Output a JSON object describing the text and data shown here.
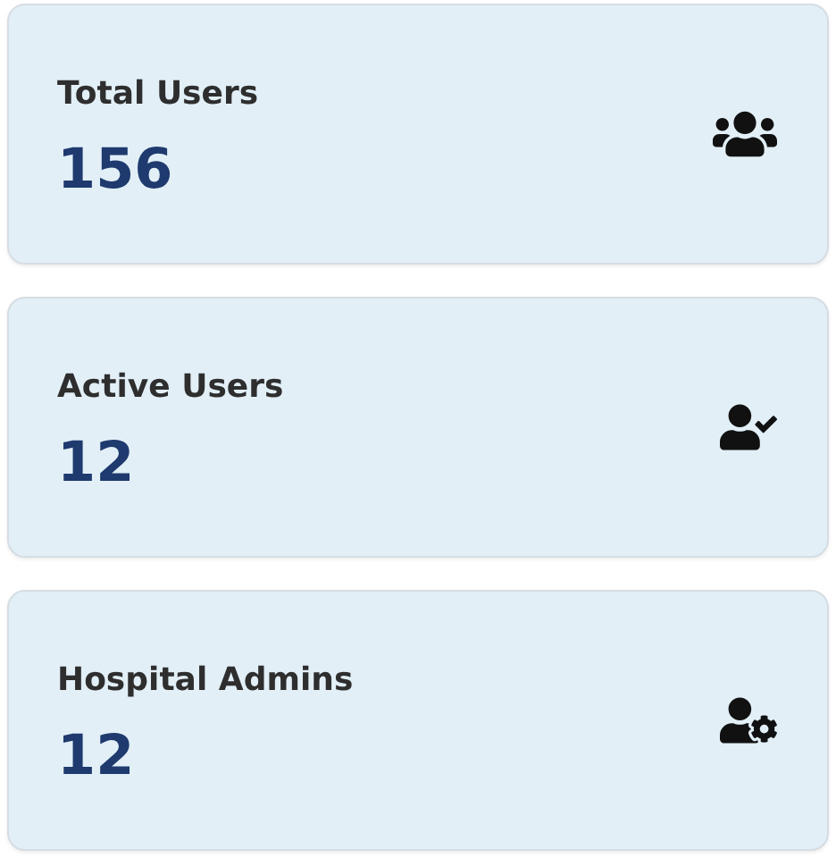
{
  "cards": [
    {
      "title": "Total Users",
      "value": "156"
    },
    {
      "title": "Active Users",
      "value": "12"
    },
    {
      "title": "Hospital Admins",
      "value": "12"
    }
  ]
}
